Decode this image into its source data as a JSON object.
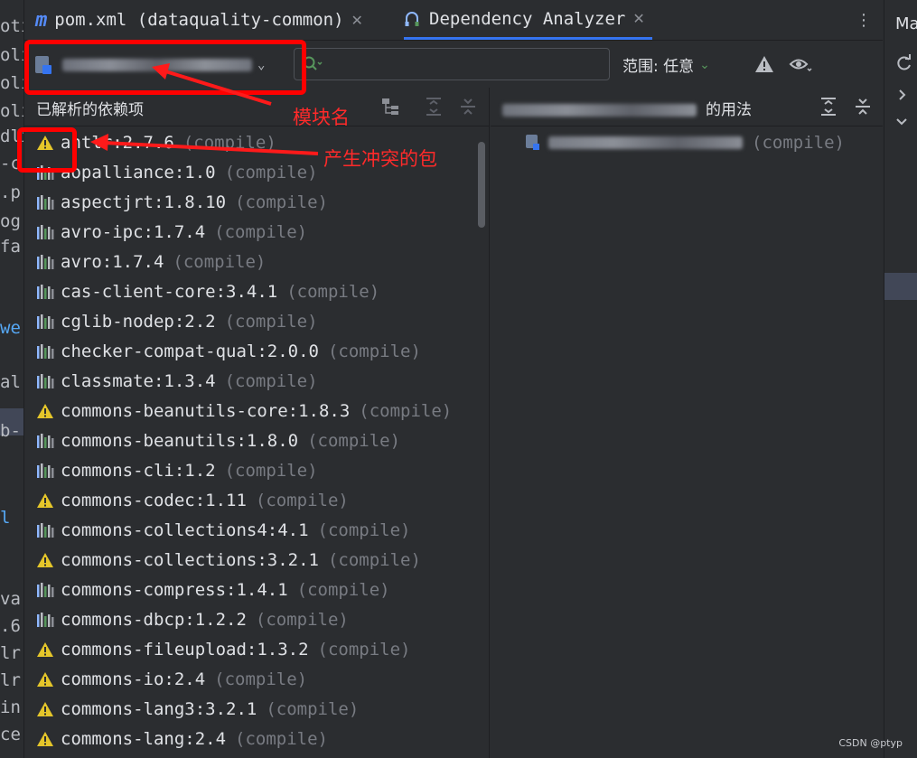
{
  "gutter_fragments": [
    "oti",
    "oli",
    "oli",
    "oli",
    "dli",
    "-c",
    ".p",
    "og",
    "fa",
    "we",
    "al",
    "b-",
    "l",
    "va",
    ".6",
    "lr",
    "lr",
    "in",
    "ce"
  ],
  "tabs": [
    {
      "label": "pom.xml (dataquality-common)",
      "icon": "maven-icon"
    },
    {
      "label": "Dependency Analyzer",
      "icon": "dependency-analyzer-icon"
    }
  ],
  "right_sidebar": {
    "label": "Ma"
  },
  "toolbar": {
    "scope_label": "范围: 任意",
    "search_placeholder": ""
  },
  "left_pane": {
    "title": "已解析的依赖项",
    "dependencies": [
      {
        "name": "antlr:2.7.6",
        "scope": "(compile)",
        "conflict": true
      },
      {
        "name": "aopalliance:1.0",
        "scope": "(compile)",
        "conflict": false
      },
      {
        "name": "aspectjrt:1.8.10",
        "scope": "(compile)",
        "conflict": false
      },
      {
        "name": "avro-ipc:1.7.4",
        "scope": "(compile)",
        "conflict": false
      },
      {
        "name": "avro:1.7.4",
        "scope": "(compile)",
        "conflict": false
      },
      {
        "name": "cas-client-core:3.4.1",
        "scope": "(compile)",
        "conflict": false
      },
      {
        "name": "cglib-nodep:2.2",
        "scope": "(compile)",
        "conflict": false
      },
      {
        "name": "checker-compat-qual:2.0.0",
        "scope": "(compile)",
        "conflict": false
      },
      {
        "name": "classmate:1.3.4",
        "scope": "(compile)",
        "conflict": false
      },
      {
        "name": "commons-beanutils-core:1.8.3",
        "scope": "(compile)",
        "conflict": true
      },
      {
        "name": "commons-beanutils:1.8.0",
        "scope": "(compile)",
        "conflict": false
      },
      {
        "name": "commons-cli:1.2",
        "scope": "(compile)",
        "conflict": false
      },
      {
        "name": "commons-codec:1.11",
        "scope": "(compile)",
        "conflict": true
      },
      {
        "name": "commons-collections4:4.1",
        "scope": "(compile)",
        "conflict": false
      },
      {
        "name": "commons-collections:3.2.1",
        "scope": "(compile)",
        "conflict": true
      },
      {
        "name": "commons-compress:1.4.1",
        "scope": "(compile)",
        "conflict": false
      },
      {
        "name": "commons-dbcp:1.2.2",
        "scope": "(compile)",
        "conflict": false
      },
      {
        "name": "commons-fileupload:1.3.2",
        "scope": "(compile)",
        "conflict": true
      },
      {
        "name": "commons-io:2.4",
        "scope": "(compile)",
        "conflict": true
      },
      {
        "name": "commons-lang3:3.2.1",
        "scope": "(compile)",
        "conflict": true
      },
      {
        "name": "commons-lang:2.4",
        "scope": "(compile)",
        "conflict": true
      }
    ]
  },
  "right_pane": {
    "title_suffix": "的用法",
    "usage_scope": "(compile)"
  },
  "annotations": {
    "module_name": "模块名",
    "conflict_package": "产生冲突的包"
  },
  "watermark": "CSDN @ptyp",
  "colors": {
    "warning": "#e5c62a",
    "accent": "#3574f0",
    "annotation": "#ff0000"
  }
}
